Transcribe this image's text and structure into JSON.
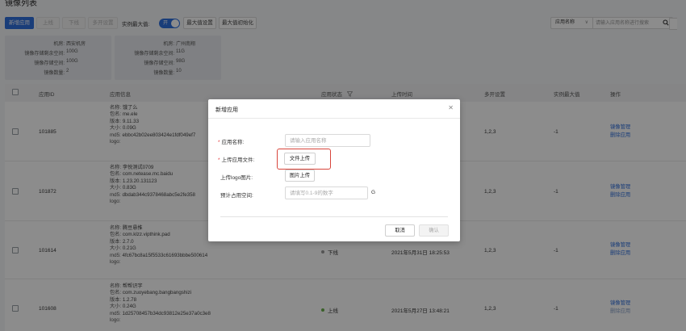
{
  "page": {
    "title": "镜像列表"
  },
  "toolbar": {
    "add_app": "新增应用",
    "online": "上线",
    "offline": "下线",
    "multi_open_settings": "多开设置",
    "instance_max_label": "实例最大值:",
    "switch_text": "开",
    "max_value_settings": "最大值设置",
    "max_value_init": "最大值初始化"
  },
  "search": {
    "field_selected": "应用名称",
    "placeholder": "请输入应用名称进行搜索"
  },
  "rooms": [
    {
      "room_label": "机房:",
      "room": "西安机房",
      "remain_label": "镜像存储剩余空间:",
      "remain": "100G",
      "total_label": "镜像存储空间:",
      "total": "100G",
      "count_label": "镜像数量:",
      "count": "2"
    },
    {
      "room_label": "机房:",
      "room": "广州南翔",
      "remain_label": "镜像存储剩余空间:",
      "remain": "11G",
      "total_label": "镜像存储空间:",
      "total": "98G",
      "count_label": "镜像数量:",
      "count": "10"
    }
  ],
  "table": {
    "headers": {
      "app_id": "应用ID",
      "app_info": "应用信息",
      "app_status": "应用状态",
      "upload_time": "上传时间",
      "multi_open": "多开设置",
      "instance_max": "实例最大值",
      "actions": "操作"
    },
    "info_labels": {
      "name": "名称:",
      "package": "包名:",
      "version": "版本:",
      "size": "大小:",
      "md5": "md5:",
      "logo": "logo:"
    },
    "rows": [
      {
        "id": "101885",
        "name": "饿了么",
        "package": "me.ele",
        "version": "9.11.33",
        "size": "0.09G",
        "md5": "ebbc42b02ee803424e1fdf049ef7",
        "status": "",
        "time": "",
        "multi": "1,2,3",
        "instance_max": "-1",
        "action1": "镜像管理",
        "action2": "删除应用"
      },
      {
        "id": "101872",
        "name": "李悦测试0709",
        "package": "com.netease.mc.baidu",
        "version": "1.23.20.131123",
        "size": "0.83G",
        "md5": "dbdab344c9378468abc5e2fe358",
        "status": "",
        "time": "",
        "multi": "1,2,3",
        "instance_max": "-1",
        "action1": "镜像管理",
        "action2": "删除应用"
      },
      {
        "id": "101614",
        "name": "腾豆悬推",
        "package": "com.klzz.vipthink.pad",
        "version": "2.7.0",
        "size": "0.21G",
        "md5": "4fc67bc8a15f5533c61693bbbe500614",
        "status": "下线",
        "time": "2021年5月31日 18:25:53",
        "multi": "1,2,3",
        "instance_max": "-1",
        "action1": "镜像管理",
        "action2": "删除应用"
      },
      {
        "id": "101608",
        "name": "帮帮识字",
        "package": "com.zuoyebang.bangbangshizi",
        "version": "1.2.78",
        "size": "0.24G",
        "md5": "1d25708457b34dc93812e25e37a0c3e8",
        "status": "上线",
        "time": "2021年5月27日 13:48:21",
        "multi": "1,2,3",
        "instance_max": "-1",
        "action1": "镜像管理",
        "action2": "删除应用"
      }
    ]
  },
  "modal": {
    "title": "新增应用",
    "app_name_label": "应用名称:",
    "app_name_placeholder": "请输入应用名称",
    "upload_file_label": "上传应用文件:",
    "upload_file_button": "文件上传",
    "upload_logo_label": "上传logo图片:",
    "upload_logo_button": "图片上传",
    "space_label": "预计占用空间:",
    "space_placeholder": "请填写0.1-9的数字",
    "space_unit": "G",
    "required_mark": "*",
    "cancel": "取消",
    "confirm": "确认"
  },
  "colors": {
    "primary": "#2f6fdc",
    "required": "#e4393c",
    "highlight": "#d8453b"
  }
}
